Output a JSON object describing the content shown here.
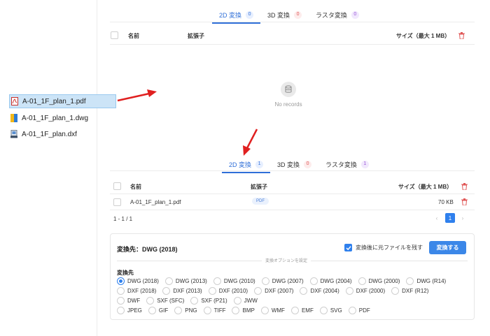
{
  "top_panel": {
    "tabs": [
      {
        "label": "2D 変換",
        "count": "0"
      },
      {
        "label": "3D 変換",
        "count": "0"
      },
      {
        "label": "ラスタ変換",
        "count": "0"
      }
    ],
    "columns": {
      "name": "名前",
      "ext": "拡張子",
      "size": "サイズ（最大 1 MB）"
    },
    "empty_text": "No records"
  },
  "files": [
    {
      "name": "A-01_1F_plan_1.pdf",
      "icon": "pdf-file-icon"
    },
    {
      "name": "A-01_1F_plan_1.dwg",
      "icon": "dwg-file-icon"
    },
    {
      "name": "A-01_1F_plan.dxf",
      "icon": "dxf-file-icon"
    }
  ],
  "bottom_panel": {
    "tabs": [
      {
        "label": "2D 変換",
        "count": "1"
      },
      {
        "label": "3D 変換",
        "count": "0"
      },
      {
        "label": "ラスタ変換",
        "count": "1"
      }
    ],
    "columns": {
      "name": "名前",
      "ext": "拡張子",
      "size": "サイズ（最大 1 MB）"
    },
    "rows": [
      {
        "name": "A-01_1F_plan_1.pdf",
        "ext": "PDF",
        "size": "70 KB"
      }
    ],
    "pager": {
      "range": "1 - 1 / 1",
      "current": "1",
      "prev": "‹",
      "next": "›"
    }
  },
  "options": {
    "destination": "変換先：DWG (2018)",
    "keep_label": "変換後に元ファイルを残す",
    "convert_label": "変換する",
    "separator": "変換オプションを設定",
    "section_label": "変換先",
    "rows": [
      [
        "DWG (2018)",
        "DWG (2013)",
        "DWG (2010)",
        "DWG (2007)",
        "DWG (2004)",
        "DWG (2000)",
        "DWG (R14)"
      ],
      [
        "DXF (2018)",
        "DXF (2013)",
        "DXF (2010)",
        "DXF (2007)",
        "DXF (2004)",
        "DXF (2000)",
        "DXF (R12)"
      ],
      [
        "DWF",
        "SXF (SFC)",
        "SXF (P21)",
        "JWW"
      ],
      [
        "JPEG",
        "GIF",
        "PNG",
        "TIFF",
        "BMP",
        "WMF",
        "EMF",
        "SVG",
        "PDF"
      ]
    ],
    "selected": "DWG (2018)"
  },
  "colors": {
    "accent": "#2f80ed",
    "arrow": "#e02020",
    "delete": "#e05757"
  }
}
